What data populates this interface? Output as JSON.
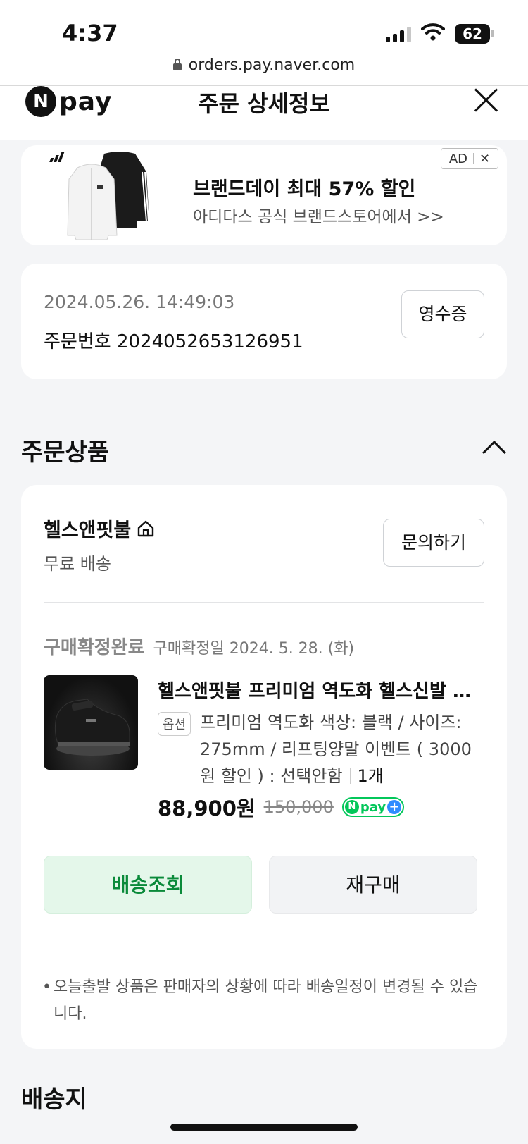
{
  "status_bar": {
    "time": "4:37",
    "battery": "62",
    "url": "orders.pay.naver.com"
  },
  "header": {
    "logo_letter": "N",
    "logo_text": "pay",
    "title": "주문 상세정보"
  },
  "ad": {
    "title": "브랜드데이 최대 57% 할인",
    "subtitle": "아디다스 공식 브랜드스토어에서 >>",
    "tag": "AD",
    "close": "✕"
  },
  "order": {
    "datetime": "2024.05.26. 14:49:03",
    "number": "주문번호 2024052653126951",
    "receipt_label": "영수증"
  },
  "section": {
    "ordered_items": "주문상품",
    "shipping": "배송지"
  },
  "product": {
    "store": "헬스앤핏불",
    "shipping_fee": "무료 배송",
    "inquiry_label": "문의하기",
    "status": "구매확정완료",
    "status_date": "구매확정일 2024. 5. 28. (화)",
    "name": "헬스앤핏불 프리미엄 역도화 헬스신발 역도화 웨이트 리프팅화",
    "option_badge": "옵션",
    "option_text": "프리미엄 역도화 색상: 블랙 / 사이즈: 275mm / 리프팅양말 이벤트 ( 3000원 할인 ) : 선택안함",
    "quantity": "1개",
    "price": "88,900원",
    "original_price": "150,000",
    "npay_plus": "pay",
    "track_label": "배송조회",
    "rebuy_label": "재구매",
    "notice": "오늘출발 상품은 판매자의 상황에 따라 배송일정이 변경될 수 있습니다."
  },
  "colors": {
    "accent_green": "#03c75a",
    "track_bg": "#e4f7ea",
    "track_text": "#0a8a3a",
    "page_bg": "#f4f5f7"
  }
}
